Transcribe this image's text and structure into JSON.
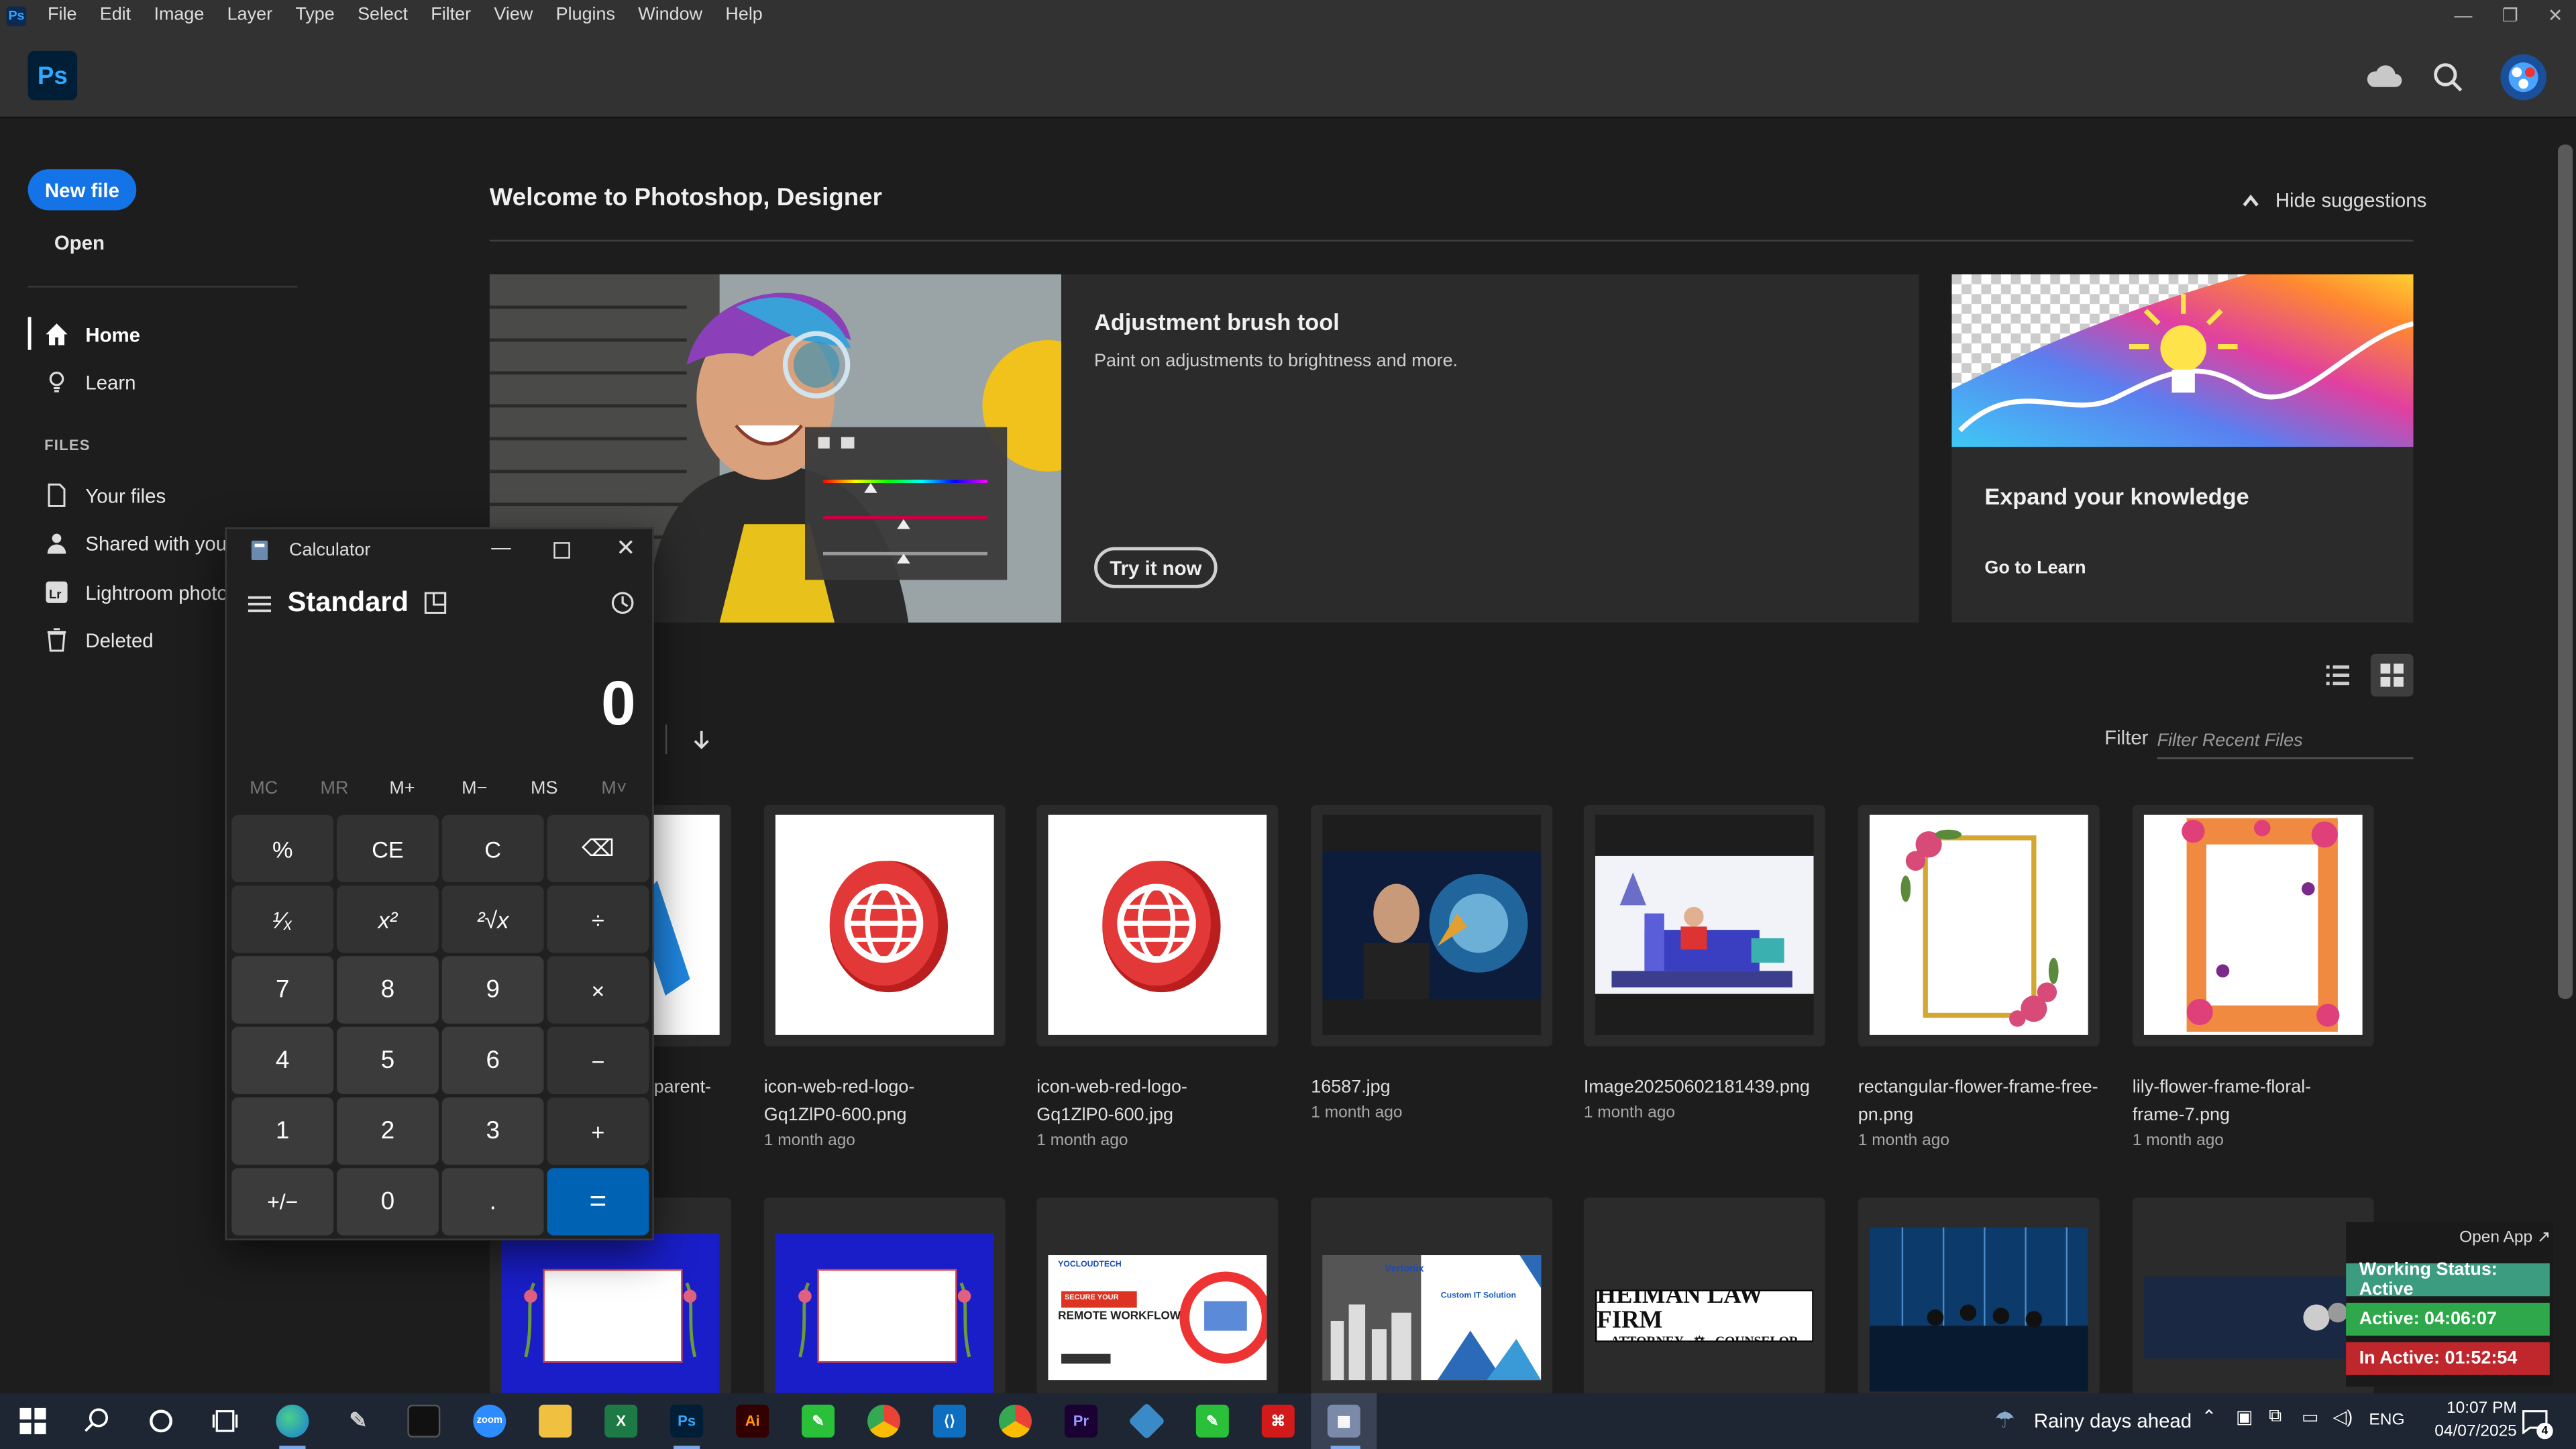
{
  "menubar": {
    "logo": "Ps",
    "items": [
      "File",
      "Edit",
      "Image",
      "Layer",
      "Type",
      "Select",
      "Filter",
      "View",
      "Plugins",
      "Window",
      "Help"
    ]
  },
  "header": {
    "logo": "Ps",
    "icons": [
      "cloud-icon",
      "search-icon",
      "avatar"
    ]
  },
  "sidebar": {
    "new_file": "New file",
    "open": "Open",
    "home": "Home",
    "learn": "Learn",
    "files_heading": "FILES",
    "your_files": "Your files",
    "shared": "Shared with you",
    "lightroom": "Lightroom photos",
    "deleted": "Deleted"
  },
  "welcome": {
    "title": "Welcome to Photoshop, Designer",
    "hide_suggestions": "Hide suggestions"
  },
  "suggestion": {
    "title": "Adjustment brush tool",
    "desc": "Paint on adjustments to brightness and more.",
    "button": "Try it now"
  },
  "knowledge": {
    "title": "Expand your knowledge",
    "link": "Go to Learn"
  },
  "recent": {
    "filter_label": "Filter",
    "filter_placeholder": "Filter Recent Files",
    "row1": [
      {
        "name": "parent-",
        "date": "",
        "kind": "partial"
      },
      {
        "name": "icon-web-red-logo-\nGq1ZlP0-600.png",
        "date": "1 month ago",
        "kind": "globe"
      },
      {
        "name": "icon-web-red-logo-\nGq1ZlP0-600.jpg",
        "date": "1 month ago",
        "kind": "globe"
      },
      {
        "name": "16587.jpg",
        "date": "1 month ago",
        "kind": "ai"
      },
      {
        "name": "Image20250602181439.png",
        "date": "1 month ago",
        "kind": "sofa"
      },
      {
        "name": "rectangular-flower-frame-free-\npn.png",
        "date": "1 month ago",
        "kind": "frame"
      },
      {
        "name": "lily-flower-frame-floral-\nframe-7.png",
        "date": "1 month ago",
        "kind": "lily"
      }
    ],
    "row2_texts": {
      "tech_brand": "YOCLOUDTECH",
      "tech_headline": "REMOTE WORKFLOW",
      "tech_tag": "SECURE YOUR",
      "verton_brand": "Vertonix",
      "verton_headline": "Custom IT Solution",
      "law_line1": "HEIMAN LAW FIRM",
      "law_line2": "ATTORNEY",
      "law_line3": "COUNSELOR"
    }
  },
  "calculator": {
    "title": "Calculator",
    "mode": "Standard",
    "display": "0",
    "memory": [
      "MC",
      "MR",
      "M+",
      "M−",
      "MS",
      "M˅"
    ],
    "keys": [
      [
        "%",
        "CE",
        "C",
        "⌫"
      ],
      [
        "¹⁄ₓ",
        "x²",
        "²√x",
        "÷"
      ],
      [
        "7",
        "8",
        "9",
        "×"
      ],
      [
        "4",
        "5",
        "6",
        "−"
      ],
      [
        "1",
        "2",
        "3",
        "+"
      ],
      [
        "+/−",
        "0",
        ".",
        "="
      ]
    ]
  },
  "status_widget": {
    "open_app": "Open App ↗",
    "working": "Working Status: Active",
    "active": "Active: 04:06:07",
    "inactive": "In Active: 01:52:54",
    "colors": {
      "working": "#3c9c80",
      "active": "#2ea84a",
      "inactive": "#c0272d"
    }
  },
  "taskbar": {
    "weather": "Rainy days ahead",
    "lang": "ENG",
    "time": "10:07 PM",
    "date": "04/07/2025",
    "notifications": "4",
    "apps": [
      "start-icon",
      "search-icon",
      "cortana-icon",
      "task-view-icon",
      "edge-icon",
      "pen-icon",
      "terminal-icon",
      "zoom-icon",
      "file-explorer-icon",
      "excel-icon",
      "photoshop-icon",
      "illustrator-icon",
      "green-app-icon",
      "chrome-icon",
      "vscode-icon",
      "chrome-alt-icon",
      "premiere-icon",
      "app-icon",
      "green-app2-icon",
      "acrobat-icon",
      "calculator-icon"
    ],
    "app_labels": {
      "zoom": "zoom",
      "ps": "Ps",
      "ai": "Ai",
      "pr": "Pr"
    }
  }
}
